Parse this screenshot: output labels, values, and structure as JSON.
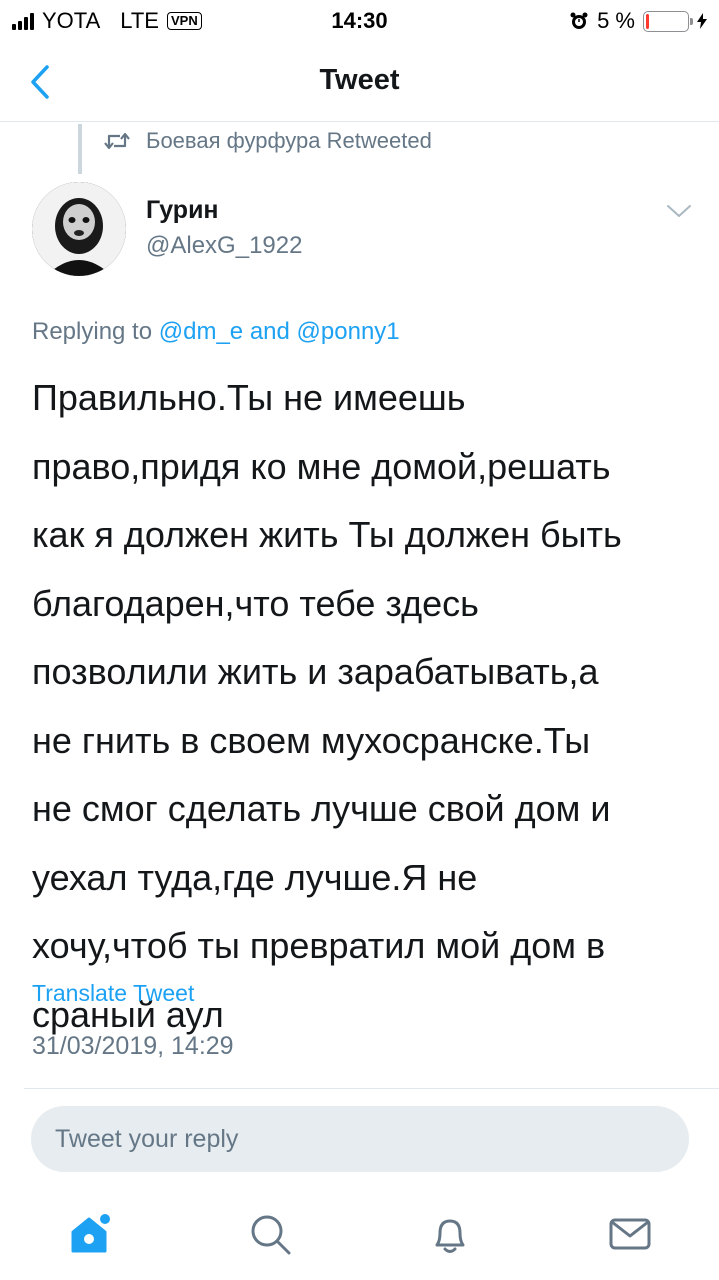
{
  "status_bar": {
    "carrier": "YOTA",
    "network": "LTE",
    "vpn": "VPN",
    "time": "14:30",
    "battery_percent_text": "5 %",
    "battery_level": 0.05
  },
  "header": {
    "title": "Tweet"
  },
  "retweet": {
    "text": "Боевая фурфура Retweeted"
  },
  "author": {
    "name": "Гурин",
    "handle": "@AlexG_1922"
  },
  "reply_to": {
    "prefix": "Replying to",
    "mention1": "@dm_e",
    "conjunction": "and",
    "mention2": "@ponny1"
  },
  "tweet": {
    "lines": [
      "Правильно.Ты не имеешь",
      "право,придя ко мне домой,решать",
      "как я должен жить Ты должен быть",
      "благодарен,что тебе здесь",
      "позволили жить и зарабатывать,а",
      "не гнить в своем мухосранске.Ты",
      "не смог сделать лучше свой дом и",
      "уехал туда,где лучше.Я не",
      "хочу,чтоб ты превратил мой дом в",
      "сраный аул"
    ],
    "translate_label": "Translate Tweet",
    "timestamp": "31/03/2019, 14:29"
  },
  "reply_box": {
    "placeholder": "Tweet your reply"
  },
  "tabs": {
    "items": [
      "home-icon",
      "search-icon",
      "notifications-icon",
      "messages-icon"
    ],
    "accent_color": "#1da1f2",
    "inactive_color": "#657786"
  }
}
